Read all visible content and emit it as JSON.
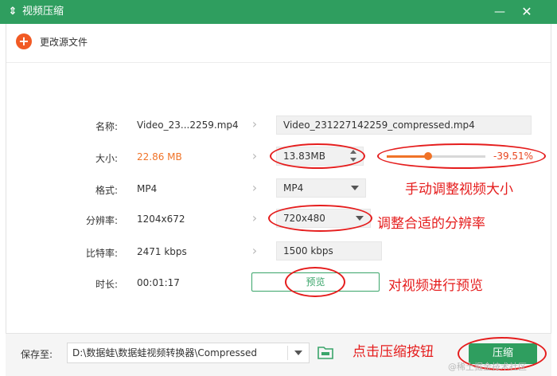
{
  "window": {
    "title": "视频压缩",
    "icon": "compress-icon",
    "minimize_glyph": "—",
    "close_glyph": "✕"
  },
  "toolbar": {
    "change_source_label": "更改源文件"
  },
  "rows": {
    "name": {
      "label": "名称:",
      "source": "Video_23...2259.mp4",
      "output": "Video_231227142259_compressed.mp4"
    },
    "size": {
      "label": "大小:",
      "source": "22.86 MB",
      "output": "13.83MB",
      "slider_percent_text": "-39.51%",
      "slider_level": 0.42
    },
    "format": {
      "label": "格式:",
      "source": "MP4",
      "output": "MP4"
    },
    "resolution": {
      "label": "分辨率:",
      "source": "1204x672",
      "output": "720x480"
    },
    "bitrate": {
      "label": "比特率:",
      "source": "2471 kbps",
      "output": "1500 kbps"
    },
    "duration": {
      "label": "时长:",
      "source": "00:01:17",
      "preview_label": "预览"
    }
  },
  "footer": {
    "save_label": "保存至:",
    "save_path": "D:\\数据蛙\\数据蛙视频转换器\\Compressed",
    "compress_label": "压缩"
  },
  "annotations": {
    "size": "手动调整视频大小",
    "resolution": "调整合适的分辨率",
    "preview": "对视频进行预览",
    "compress": "点击压缩按钮"
  },
  "watermark": "@稀土掘金技术社区",
  "colors": {
    "brand_green": "#2f9e5f",
    "accent_orange": "#f07328",
    "annotation_red": "#e51d1d"
  }
}
